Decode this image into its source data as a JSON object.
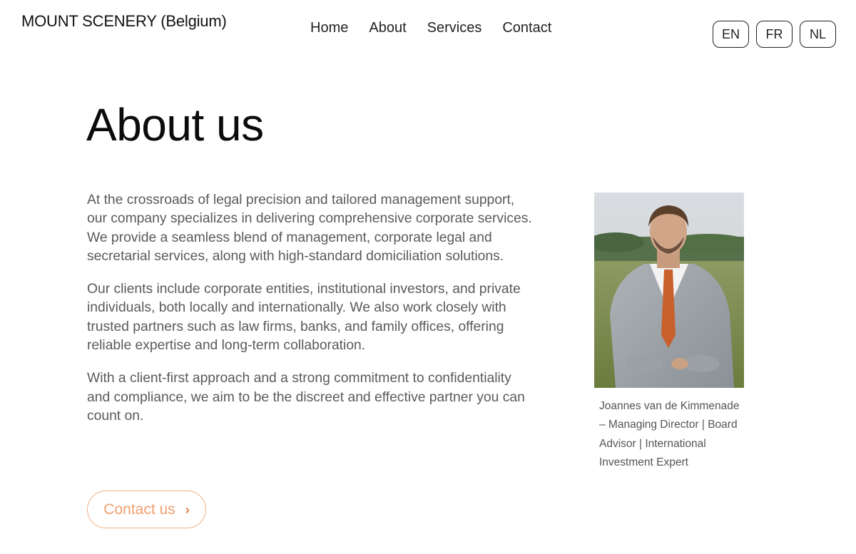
{
  "header": {
    "brand": "MOUNT SCENERY (Belgium)",
    "nav": [
      "Home",
      "About",
      "Services",
      "Contact"
    ],
    "languages": [
      "EN",
      "FR",
      "NL"
    ]
  },
  "main": {
    "title": "About us",
    "paragraphs": [
      "At the crossroads of legal precision and tailored management support, our company specializes in delivering comprehensive corporate services. We provide a seamless blend of management, corporate legal and secretarial services, along with high-standard domiciliation solutions.",
      " Our clients include corporate entities, institutional investors, and private individuals, both locally and internationally. We also work closely with trusted partners such as law firms, banks, and family offices, offering reliable expertise and long-term collaboration.",
      " With a client-first approach and a strong commitment to confidentiality and compliance, we aim to be the discreet and effective partner you can count on."
    ],
    "portrait_caption": "Joannes van de Kimmenade – Managing Director | Board Advisor | International Investment Expert",
    "cta_label": "Contact us",
    "cta_icon": "chevron-right-icon"
  },
  "colors": {
    "accent": "#f0a06f",
    "accent_border": "#f0b188",
    "text_muted": "#5a5a5a"
  }
}
